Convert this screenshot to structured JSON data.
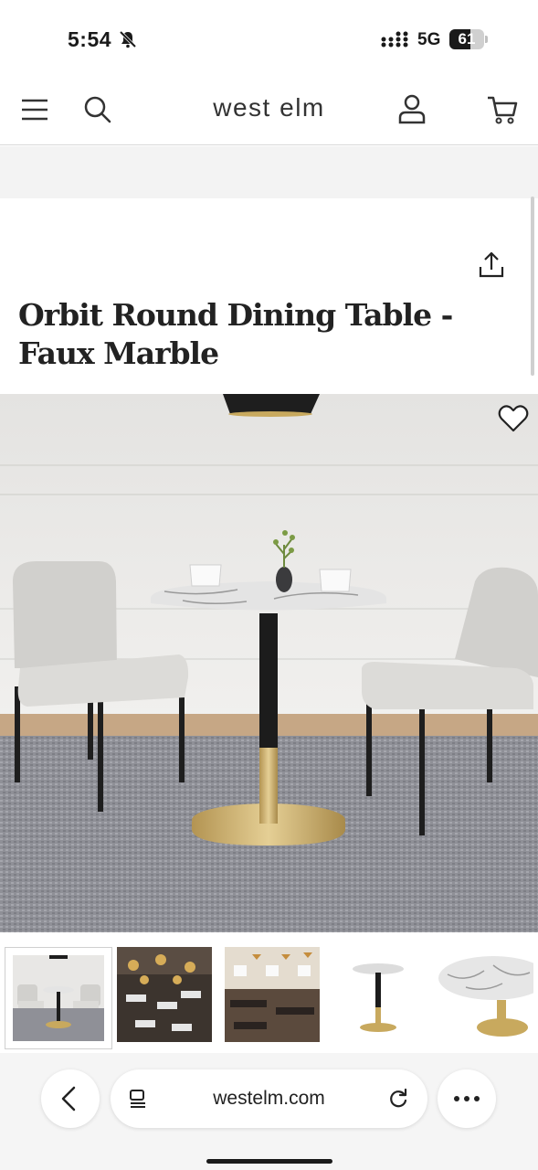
{
  "status_bar": {
    "time": "5:54",
    "network": "5G",
    "battery_level": 61,
    "battery_text": "61"
  },
  "header": {
    "brand": "west elm",
    "icons": [
      "menu-icon",
      "search-icon",
      "account-icon",
      "cart-icon"
    ]
  },
  "product": {
    "title": "Orbit Round Dining Table - Faux Marble",
    "icons": [
      "share-icon",
      "heart-icon"
    ]
  },
  "thumbnails": [
    {
      "name": "thumbnail-table-with-chairs",
      "selected": true
    },
    {
      "name": "thumbnail-restaurant-interior-1",
      "selected": false
    },
    {
      "name": "thumbnail-restaurant-interior-2",
      "selected": false
    },
    {
      "name": "thumbnail-table-silo",
      "selected": false
    },
    {
      "name": "thumbnail-marble-top-closeup",
      "selected": false
    }
  ],
  "browser": {
    "url": "westelm.com",
    "icons": [
      "back-icon",
      "tabs-icon",
      "reload-icon",
      "more-icon"
    ]
  },
  "colors": {
    "brass": "#c8a95e",
    "marble": "#e6e6e6",
    "rug": "#8d8e95",
    "chair": "#d6d5d2"
  }
}
